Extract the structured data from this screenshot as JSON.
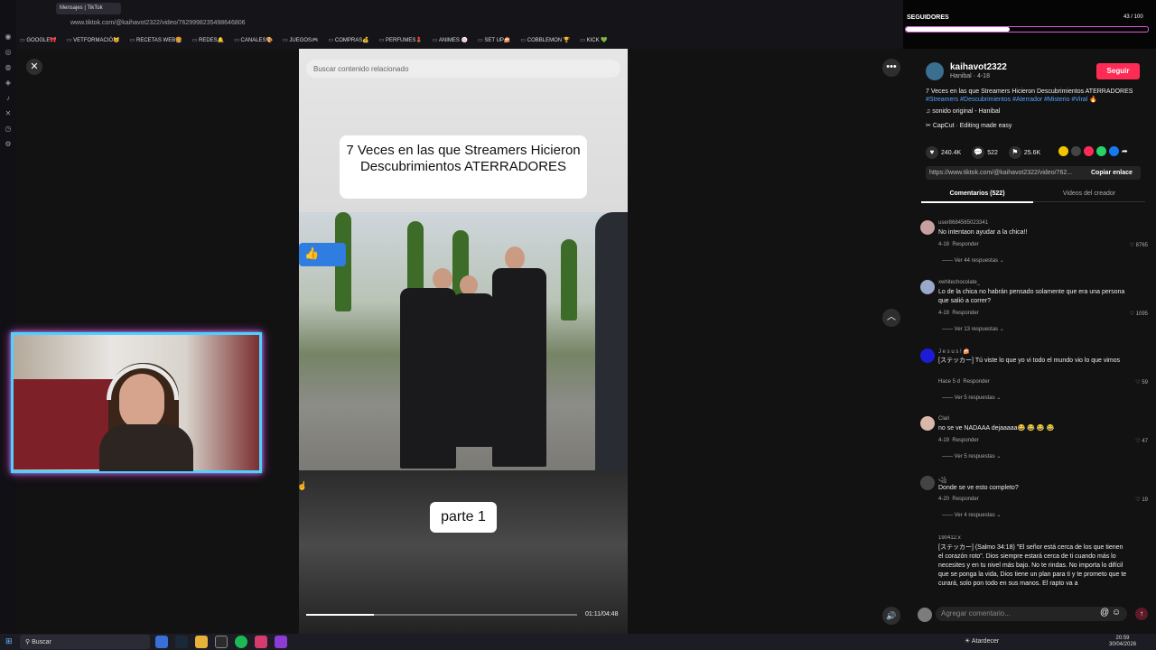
{
  "browser": {
    "tab_title": "Mensajes | TikTok",
    "url": "www.tiktok.com/@kaihavot2322/video/7629998235498646806",
    "bookmarks": [
      "GOOGLE🎀",
      "VETFORMACIÓ😸",
      "RECETAS WEB🍔",
      "REDES🔔",
      "CANALES🎨",
      "JUEGOS🎮",
      "COMPRAS💰",
      "PERFUMES💄",
      "ANIMES 🍥",
      "SET UP🍰",
      "COBBLEMON 🏆",
      "KICK 💚"
    ]
  },
  "video": {
    "search_placeholder": "Buscar contenido relacionado",
    "overlay_title": "7 Veces en las que Streamers Hicieron Descubrimientos ATERRADORES",
    "part_label": "parte 1",
    "time": "01:11/04:48",
    "progress": 0.25
  },
  "stream_overlay": {
    "followers_label": "SEGUIDORES",
    "followers_count": "43 / 100",
    "followers_progress": 0.43
  },
  "post": {
    "username": "kaihavot2322",
    "subline": "Hanibal · 4-18",
    "follow_label": "Seguir",
    "description": "7 Veces en las que Streamers Hicieron Descubrimientos ATERRADORES",
    "hashtags": "#Streamers #Descubrimientos #Aterrador #Misterio #Viral 🔥",
    "sound": "sonido original - Hanibal",
    "capcut": "CapCut · Editing made easy",
    "likes": "240.4K",
    "comments": "522",
    "saves": "25.6K",
    "link": "https://www.tiktok.com/@kaihavot2322/video/762...",
    "copy_label": "Copiar enlace",
    "tab_comments": "Comentarios (522)",
    "tab_creator": "Videos del creador"
  },
  "comments": [
    {
      "user": "user8684565023341",
      "text": "No intentaon ayudar a la chica!!",
      "date": "4-18",
      "likes": "8765",
      "replies": "Ver 44 respuestas",
      "color": "#c9a0a0"
    },
    {
      "user": "xwhitechocolate_",
      "text": "Lo de la chica no habrán pensado solamente que era una persona que salió a correr?",
      "date": "4-19",
      "likes": "1095",
      "replies": "Ver 13 respuestas",
      "color": "#9aa8c9"
    },
    {
      "user": "J e s u s ! 🍰",
      "text": "[ステッカー] Tú viste lo que yo vi todo el mundo vio lo que vimos",
      "date": "Hace 5 d",
      "likes": "59",
      "replies": "Ver 5 respuestas",
      "color": "#1c1cd6"
    },
    {
      "user": "Clari",
      "text": "no se ve NADAAA dejaaaaa😂 😂 😂 😂",
      "date": "4-19",
      "likes": "47",
      "replies": "Ver 5 respuestas",
      "color": "#d8b8a8"
    },
    {
      "user": "꧁",
      "text": "Donde se ve esto completo?",
      "date": "4-20",
      "likes": "19",
      "replies": "Ver 4 respuestas",
      "color": "#444"
    },
    {
      "user": "190412.x",
      "text": "[ステッカー] (Salmo 34:18) \"El señor está cerca de los que tienen el corazón roto\". Dios siempre estará cerca de ti cuando más lo necesites y en tu nivel más bajo. No te rindas. No importa lo difícil que se ponga la vida, Dios tiene un plan para ti y te prometo que te curará, solo pon todo en sus manos. El rapto va a",
      "date": "",
      "likes": "",
      "replies": "",
      "color": "#121212"
    }
  ],
  "reply_label": "Responder",
  "add_comment_placeholder": "Agregar comentario...",
  "taskbar": {
    "search": "Buscar",
    "weather": "Atardecer",
    "time": "20:59",
    "date": "30/04/2026"
  }
}
